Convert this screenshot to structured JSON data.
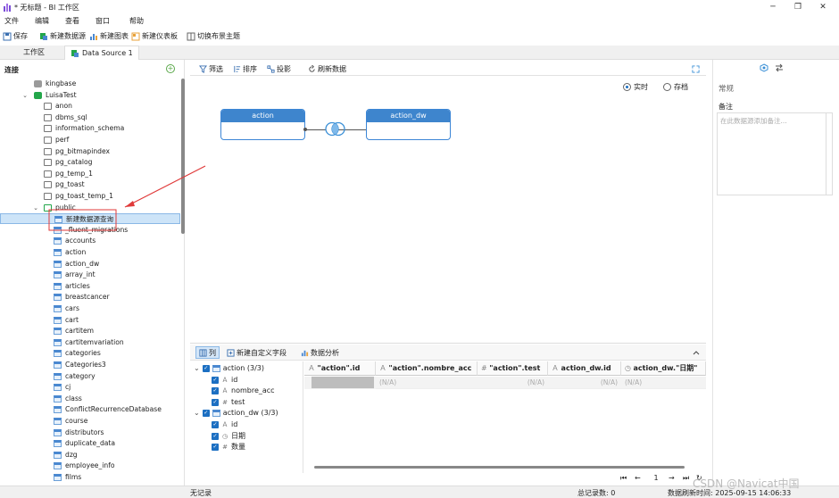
{
  "window": {
    "title": "* 无标题 - BI 工作区",
    "minimize": "─",
    "maximize": "❐",
    "close": "✕"
  },
  "menu": [
    "文件",
    "编辑",
    "查看",
    "窗口",
    "帮助"
  ],
  "toolbar": {
    "save": "保存",
    "new_datasource": "新建数据源",
    "new_chart": "新建图表",
    "new_dashboard": "新建仪表板",
    "toggle_layout": "切换布景主题"
  },
  "tabs": {
    "workspace": "工作区",
    "datasource": "Data Source 1"
  },
  "sidebar": {
    "title": "连接",
    "tree": [
      {
        "label": "kingbase",
        "icon": "db",
        "level": 1,
        "chevron": ""
      },
      {
        "label": "LuisaTest",
        "icon": "dbg",
        "level": 1,
        "chevron": "v"
      },
      {
        "label": "anon",
        "icon": "schema",
        "level": 2,
        "chevron": ""
      },
      {
        "label": "dbms_sql",
        "icon": "schema",
        "level": 2,
        "chevron": ""
      },
      {
        "label": "information_schema",
        "icon": "schema",
        "level": 2,
        "chevron": ""
      },
      {
        "label": "perf",
        "icon": "schema",
        "level": 2,
        "chevron": ""
      },
      {
        "label": "pg_bitmapindex",
        "icon": "schema",
        "level": 2,
        "chevron": ""
      },
      {
        "label": "pg_catalog",
        "icon": "schema",
        "level": 2,
        "chevron": ""
      },
      {
        "label": "pg_temp_1",
        "icon": "schema",
        "level": 2,
        "chevron": ""
      },
      {
        "label": "pg_toast",
        "icon": "schema",
        "level": 2,
        "chevron": ""
      },
      {
        "label": "pg_toast_temp_1",
        "icon": "schema",
        "level": 2,
        "chevron": ""
      },
      {
        "label": "public",
        "icon": "schemag",
        "level": 2,
        "chevron": "v"
      },
      {
        "label": "新建数据源查询",
        "icon": "query",
        "level": 3,
        "chevron": "",
        "selected": true
      },
      {
        "label": "_fluent_migrations",
        "icon": "table",
        "level": 3,
        "chevron": ""
      },
      {
        "label": "accounts",
        "icon": "table",
        "level": 3,
        "chevron": ""
      },
      {
        "label": "action",
        "icon": "table",
        "level": 3,
        "chevron": ""
      },
      {
        "label": "action_dw",
        "icon": "table",
        "level": 3,
        "chevron": ""
      },
      {
        "label": "array_int",
        "icon": "table",
        "level": 3,
        "chevron": ""
      },
      {
        "label": "articles",
        "icon": "table",
        "level": 3,
        "chevron": ""
      },
      {
        "label": "breastcancer",
        "icon": "table",
        "level": 3,
        "chevron": ""
      },
      {
        "label": "cars",
        "icon": "table",
        "level": 3,
        "chevron": ""
      },
      {
        "label": "cart",
        "icon": "table",
        "level": 3,
        "chevron": ""
      },
      {
        "label": "cartitem",
        "icon": "table",
        "level": 3,
        "chevron": ""
      },
      {
        "label": "cartitemvariation",
        "icon": "table",
        "level": 3,
        "chevron": ""
      },
      {
        "label": "categories",
        "icon": "table",
        "level": 3,
        "chevron": ""
      },
      {
        "label": "Categories3",
        "icon": "table",
        "level": 3,
        "chevron": ""
      },
      {
        "label": "category",
        "icon": "table",
        "level": 3,
        "chevron": ""
      },
      {
        "label": "cj",
        "icon": "table",
        "level": 3,
        "chevron": ""
      },
      {
        "label": "class",
        "icon": "table",
        "level": 3,
        "chevron": ""
      },
      {
        "label": "ConflictRecurrenceDatabase",
        "icon": "table",
        "level": 3,
        "chevron": ""
      },
      {
        "label": "course",
        "icon": "table",
        "level": 3,
        "chevron": ""
      },
      {
        "label": "distributors",
        "icon": "table",
        "level": 3,
        "chevron": ""
      },
      {
        "label": "duplicate_data",
        "icon": "table",
        "level": 3,
        "chevron": ""
      },
      {
        "label": "dzg",
        "icon": "table",
        "level": 3,
        "chevron": ""
      },
      {
        "label": "employee_info",
        "icon": "table",
        "level": 3,
        "chevron": ""
      },
      {
        "label": "films",
        "icon": "table",
        "level": 3,
        "chevron": ""
      }
    ]
  },
  "editor": {
    "filter": "筛选",
    "sort": "排序",
    "projection": "投影",
    "refresh": "刷新数据",
    "mode_live": "实时",
    "mode_store": "存档",
    "node_left": "action",
    "node_right": "action_dw"
  },
  "bottom": {
    "tab_columns": "列",
    "tab_new_field": "新建自定义字段",
    "tab_analysis": "数据分析",
    "fields": [
      {
        "label": "action (3/3)",
        "type": "group"
      },
      {
        "label": "id",
        "type": "text"
      },
      {
        "label": "nombre_acc",
        "type": "text"
      },
      {
        "label": "test",
        "type": "num"
      },
      {
        "label": "action_dw (3/3)",
        "type": "group"
      },
      {
        "label": "id",
        "type": "text"
      },
      {
        "label": "日期",
        "type": "date"
      },
      {
        "label": "数量",
        "type": "num"
      }
    ],
    "grid_headers": [
      {
        "label": "\"action\".id",
        "type": "text"
      },
      {
        "label": "\"action\".nombre_acc",
        "type": "text"
      },
      {
        "label": "\"action\".test",
        "type": "num"
      },
      {
        "label": "action_dw.id",
        "type": "text"
      },
      {
        "label": "action_dw.\"日期\"",
        "type": "date"
      }
    ],
    "grid_row": [
      "",
      "(N/A)",
      "(N/A)",
      "(N/A)",
      "(N/A)"
    ],
    "page": "1"
  },
  "status": {
    "left": "无记录",
    "count": "总记录数: 0",
    "refresh_time": "数据刷新时间: 2025-09-15 14:06:33"
  },
  "rightpanel": {
    "general": "常规",
    "remark": "备注",
    "remark_placeholder": "在此数据源添加备注..."
  },
  "watermark": "CSDN @Navicat中国"
}
